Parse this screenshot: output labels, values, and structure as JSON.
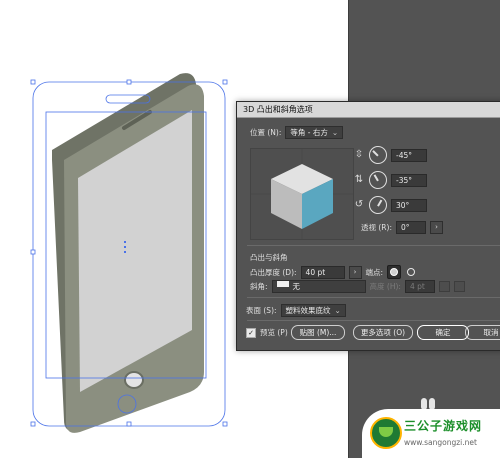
{
  "dialog": {
    "title": "3D 凸出和斜角选项",
    "position": {
      "label": "位置 (N):",
      "value": "等角 - 右方"
    },
    "rotation": {
      "x_value": "-45°",
      "y_value": "-35°",
      "z_value": "30°",
      "perspective_label": "透视 (R):",
      "perspective_value": "0°"
    },
    "extrude": {
      "section_label": "凸出与斜角",
      "depth_label": "凸出厚度 (D):",
      "depth_value": "40 pt",
      "cap_label": "端点:",
      "bevel_label": "斜角:",
      "bevel_value": "无",
      "height_label": "高度 (H):",
      "height_value": "4 pt"
    },
    "surface": {
      "label": "表面 (S):",
      "value": "塑料效果底纹"
    },
    "footer": {
      "preview_label": "预览 (P)",
      "map_button": "贴图 (M)...",
      "more_options_button": "更多选项 (O)",
      "ok_button": "确定",
      "cancel_button": "取消"
    }
  },
  "watermark": {
    "title": "三公子游戏网",
    "url": "www.sangongzi.net"
  },
  "colors": {
    "cube_top": "#e2e2e2",
    "cube_left": "#bcbcbc",
    "cube_right": "#5aa7c0",
    "phone_body": "#8b8f80",
    "phone_screen": "#d2d2d2",
    "dialog_bg": "#535353",
    "selection_blue": "#4a72e8"
  }
}
